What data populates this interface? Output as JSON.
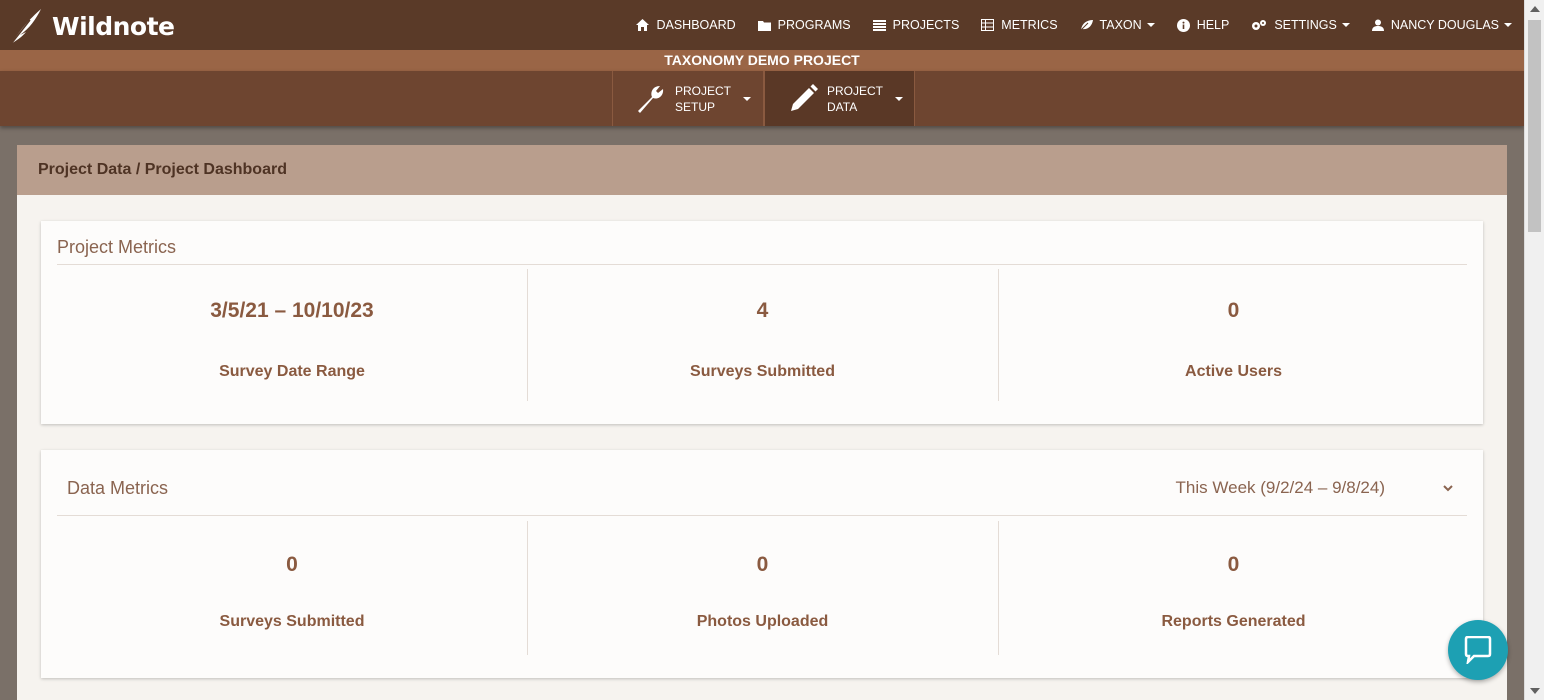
{
  "app": {
    "name": "Wildnote"
  },
  "nav": {
    "items": [
      {
        "label": "DASHBOARD",
        "icon": "home-icon"
      },
      {
        "label": "PROGRAMS",
        "icon": "folder-icon"
      },
      {
        "label": "PROJECTS",
        "icon": "list-icon"
      },
      {
        "label": "METRICS",
        "icon": "table-icon"
      },
      {
        "label": "TAXON",
        "icon": "leaf-icon"
      },
      {
        "label": "HELP",
        "icon": "info-icon"
      },
      {
        "label": "SETTINGS",
        "icon": "gears-icon"
      },
      {
        "label": "NANCY DOUGLAS",
        "icon": "user-icon"
      }
    ]
  },
  "project": {
    "title": "TAXONOMY DEMO PROJECT"
  },
  "subnav": {
    "setup": {
      "line1": "PROJECT",
      "line2": "SETUP"
    },
    "data": {
      "line1": "PROJECT",
      "line2": "DATA"
    }
  },
  "breadcrumb": "Project Data / Project Dashboard",
  "project_metrics": {
    "title": "Project Metrics",
    "items": [
      {
        "value": "3/5/21 – 10/10/23",
        "label": "Survey Date Range"
      },
      {
        "value": "4",
        "label": "Surveys Submitted"
      },
      {
        "value": "0",
        "label": "Active Users"
      }
    ]
  },
  "data_metrics": {
    "title": "Data Metrics",
    "period": "This Week (9/2/24 – 9/8/24)",
    "items": [
      {
        "value": "0",
        "label": "Surveys Submitted"
      },
      {
        "value": "0",
        "label": "Photos Uploaded"
      },
      {
        "value": "0",
        "label": "Reports Generated"
      }
    ]
  },
  "colors": {
    "topbar": "#5a3a28",
    "projbar": "#9a6546",
    "subnav": "#6e4530",
    "panel_head": "#b99e8d",
    "metric_text": "#8a5a40",
    "chat": "#1da0b3"
  }
}
